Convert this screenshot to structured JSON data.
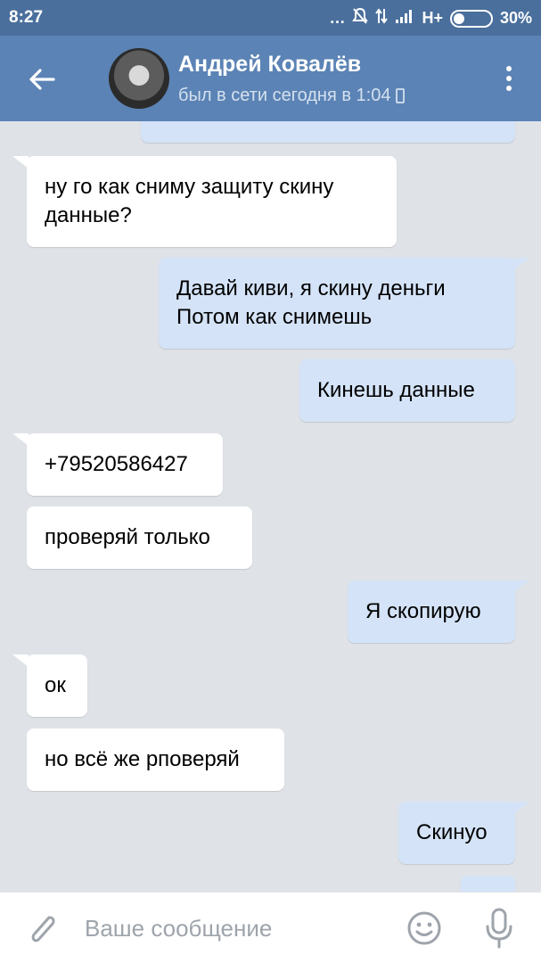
{
  "status_bar": {
    "time": "8:27",
    "network": "H+",
    "battery": "30%",
    "battery_level": 0.3
  },
  "header": {
    "name": "Андрей Ковалёв",
    "last_seen": "был в сети сегодня в 1:04"
  },
  "messages": [
    {
      "side": "out",
      "text": ""
    },
    {
      "side": "in",
      "text": "ну го как сниму защиту скину данные?"
    },
    {
      "side": "out",
      "text": "Давай киви, я скину деньги Потом как снимешь"
    },
    {
      "side": "out",
      "text": "Кинешь данные"
    },
    {
      "side": "in",
      "text": "+79520586427"
    },
    {
      "side": "in",
      "text": "проверяй только"
    },
    {
      "side": "out",
      "text": "Я скопирую"
    },
    {
      "side": "in",
      "text": "ок"
    },
    {
      "side": "in",
      "text": "но всё же рповеряй"
    },
    {
      "side": "out",
      "text": "Скинуо"
    },
    {
      "side": "out",
      "text": ""
    }
  ],
  "input": {
    "placeholder": "Ваше сообщение"
  },
  "colors": {
    "status_bar": "#4a6f9c",
    "header": "#5b83b5",
    "chat_background": "#dfe3e8",
    "incoming_bubble": "#ffffff",
    "outgoing_bubble": "#d4e3f7"
  },
  "icons": [
    "back-arrow-icon",
    "more-vertical-icon",
    "phone-icon",
    "attach-paperclip-icon",
    "emoji-smile-icon",
    "microphone-icon",
    "mute-icon",
    "signal-icon",
    "battery-icon"
  ]
}
